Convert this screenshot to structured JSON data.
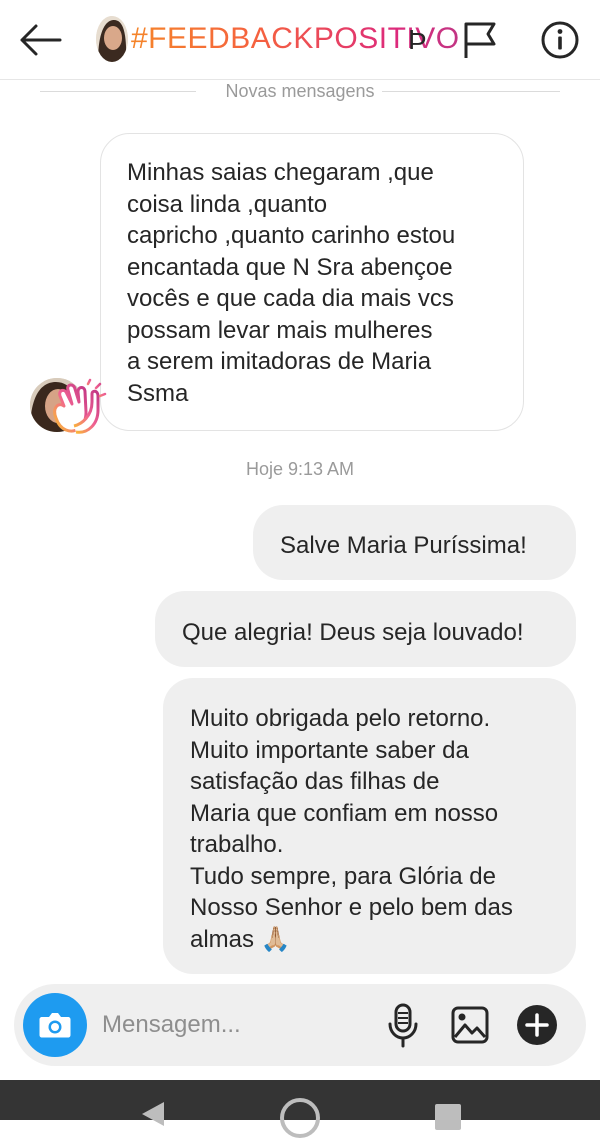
{
  "header": {
    "title": "#FEEDBACKPOSITIVO",
    "title_overflow": "Þ",
    "icons": [
      "back-arrow-icon",
      "flag-icon",
      "info-icon"
    ]
  },
  "divider": {
    "label": "Novas mensagens"
  },
  "messages": {
    "incoming": {
      "text": "Minhas saias chegaram ,que coisa linda ,quanto capricho ,quanto carinho estou encantada que N Sra abençoe vocês e que cada dia mais vcs possam levar mais mulheres a serem imitadoras de Maria Ssma",
      "lines": [
        "Minhas saias chegaram ,que",
        "coisa linda ,quanto",
        "capricho ,quanto carinho estou",
        "encantada que N Sra abençoe",
        "vocês e que cada dia mais vcs",
        "possam levar mais mulheres",
        "a serem imitadoras de Maria",
        "Ssma"
      ],
      "reaction": "clapping-hands-icon"
    },
    "timestamp": "Hoje 9:13 AM",
    "outgoing": [
      {
        "lines": [
          "Salve Maria Puríssima!"
        ]
      },
      {
        "lines": [
          "Que alegria! Deus seja louvado!"
        ]
      },
      {
        "lines": [
          "Muito obrigada pelo retorno.",
          "Muito importante saber da",
          "satisfação das filhas de",
          "Maria que confiam em nosso",
          "trabalho.",
          "Tudo sempre, para Glória de",
          "Nosso Senhor e pelo bem das",
          "almas 🙏🏼"
        ]
      }
    ]
  },
  "composer": {
    "placeholder": "Mensagem...",
    "icons": [
      "camera-icon",
      "microphone-icon",
      "gallery-icon",
      "plus-icon"
    ]
  },
  "colors": {
    "accent_blue": "#1e9bf0",
    "bubble_gray": "#efefef",
    "gradient_start": "#f58529",
    "gradient_end": "#c13584"
  }
}
